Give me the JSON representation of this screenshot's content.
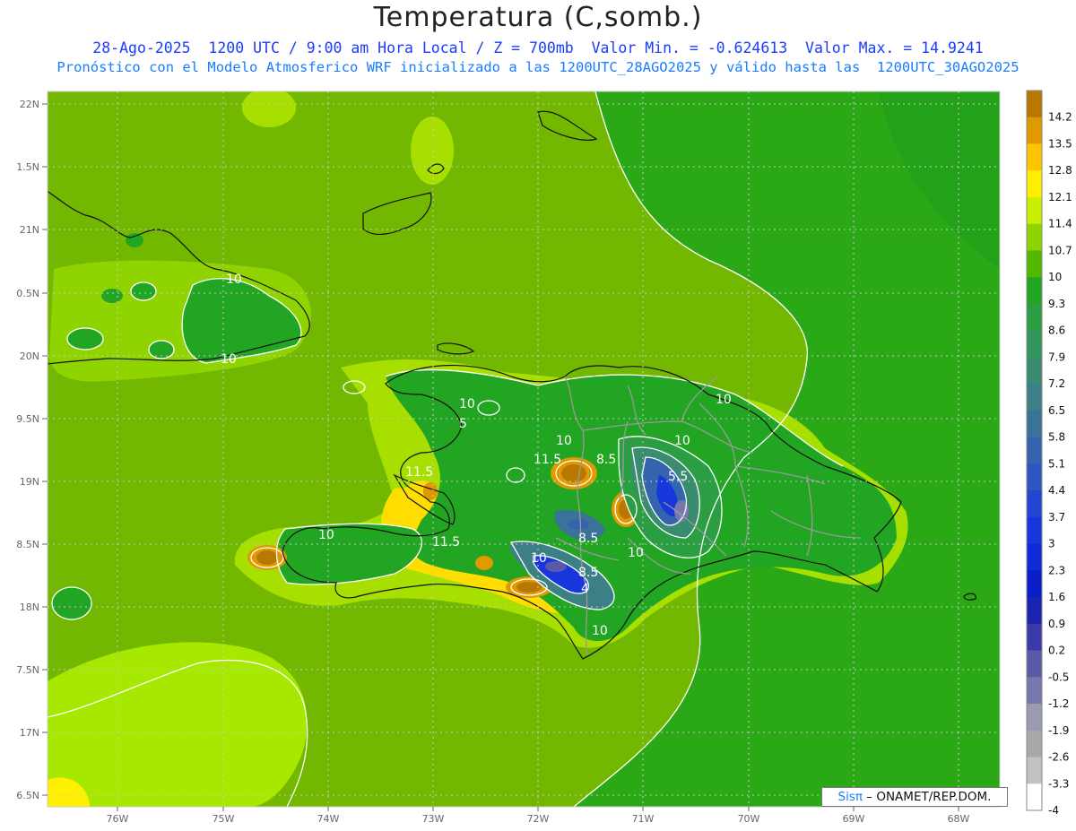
{
  "header": {
    "title": "Temperatura (C,somb.)",
    "subtitle_line1": "28-Ago-2025  1200 UTC / 9:00 am Hora Local / Z = 700mb  Valor Min. = -0.624613  Valor Max. = 14.9241",
    "subtitle_line2": "Pronóstico con el Modelo Atmosferico WRF inicializado a las 1200UTC_28AGO2025 y válido hasta las  1200UTC_30AGO2025"
  },
  "axes": {
    "y_ticks": [
      "22N",
      "1.5N",
      "21N",
      "0.5N",
      "20N",
      "9.5N",
      "19N",
      "8.5N",
      "18N",
      "7.5N",
      "17N",
      "6.5N"
    ],
    "x_ticks": [
      "76W",
      "75W",
      "74W",
      "73W",
      "72W",
      "71W",
      "70W",
      "69W",
      "68W"
    ]
  },
  "colorbar": {
    "labels": [
      "14.2",
      "13.5",
      "12.8",
      "12.1",
      "11.4",
      "10.7",
      "10",
      "9.3",
      "8.6",
      "7.9",
      "7.2",
      "6.5",
      "5.8",
      "5.1",
      "4.4",
      "3.7",
      "3",
      "2.3",
      "1.6",
      "0.9",
      "0.2",
      "-0.5",
      "-1.2",
      "-1.9",
      "-2.6",
      "-3.3",
      "-4"
    ],
    "colors": [
      "#b87800",
      "#e09a00",
      "#ffc400",
      "#ffef00",
      "#c8f000",
      "#8fd400",
      "#52b800",
      "#22a522",
      "#2b9e44",
      "#34965a",
      "#3a8c70",
      "#3c8086",
      "#3a7298",
      "#3564ae",
      "#2c56c0",
      "#2146d0",
      "#1736dc",
      "#0f28d8",
      "#0a1ec8",
      "#1a24b0",
      "#3a3aa8",
      "#5a5aa8",
      "#7878b0",
      "#9a9ab0",
      "#a8a8a8",
      "#c2c2c2",
      "#ffffff"
    ]
  },
  "contour_labels": [
    "10",
    "10",
    "10",
    "10",
    "10",
    "10",
    "10",
    "10",
    "10",
    "10",
    "5",
    "11.5",
    "11.5",
    "11.5",
    "8.5",
    "8.5",
    "5.5",
    "8.5",
    "4"
  ],
  "credit": {
    "brand": "Sisπ",
    "text": " – ONAMET/REP.DOM."
  }
}
